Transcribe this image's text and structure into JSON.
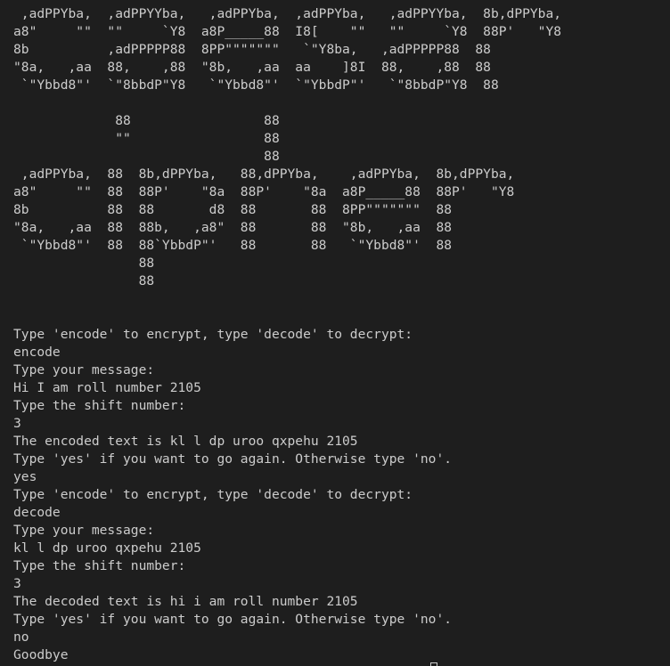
{
  "colors": {
    "background": "#1e1e1e",
    "text": "#cccccc"
  },
  "banner": [
    " ,adPPYba,  ,adPPYYba,   ,adPPYba,  ,adPPYba,   ,adPPYYba,  8b,dPPYba,",
    "a8\"     \"\"  \"\"     `Y8  a8P_____88  I8[    \"\"   \"\"     `Y8  88P'   \"Y8",
    "8b          ,adPPPPP88  8PP\"\"\"\"\"\"\"   `\"Y8ba,   ,adPPPPP88  88",
    "\"8a,   ,aa  88,    ,88  \"8b,   ,aa  aa    ]8I  88,    ,88  88",
    " `\"Ybbd8\"'  `\"8bbdP\"Y8   `\"Ybbd8\"'  `\"YbbdP\"'   `\"8bbdP\"Y8  88",
    "",
    "             88                 88",
    "             \"\"                 88",
    "                                88",
    " ,adPPYba,  88  8b,dPPYba,   88,dPPYba,    ,adPPYba,  8b,dPPYba,",
    "a8\"     \"\"  88  88P'    \"8a  88P'    \"8a  a8P_____88  88P'   \"Y8",
    "8b          88  88       d8  88       88  8PP\"\"\"\"\"\"\"  88",
    "\"8a,   ,aa  88  88b,   ,a8\"  88       88  \"8b,   ,aa  88",
    " `\"Ybbd8\"'  88  88`YbbdP\"'   88       88   `\"Ybbd8\"'  88",
    "                88",
    "                88"
  ],
  "session": [
    {
      "kind": "blank",
      "text": ""
    },
    {
      "kind": "blank",
      "text": ""
    },
    {
      "kind": "prompt",
      "text": "Type 'encode' to encrypt, type 'decode' to decrypt:"
    },
    {
      "kind": "input",
      "text": "encode"
    },
    {
      "kind": "prompt",
      "text": "Type your message:"
    },
    {
      "kind": "input",
      "text": "Hi I am roll number 2105"
    },
    {
      "kind": "prompt",
      "text": "Type the shift number:"
    },
    {
      "kind": "input",
      "text": "3"
    },
    {
      "kind": "output",
      "text": "The encoded text is kl l dp uroo qxpehu 2105"
    },
    {
      "kind": "prompt",
      "text": "Type 'yes' if you want to go again. Otherwise type 'no'."
    },
    {
      "kind": "input",
      "text": "yes"
    },
    {
      "kind": "prompt",
      "text": "Type 'encode' to encrypt, type 'decode' to decrypt:"
    },
    {
      "kind": "input",
      "text": "decode"
    },
    {
      "kind": "prompt",
      "text": "Type your message:"
    },
    {
      "kind": "input",
      "text": "kl l dp uroo qxpehu 2105"
    },
    {
      "kind": "prompt",
      "text": "Type the shift number:"
    },
    {
      "kind": "input",
      "text": "3"
    },
    {
      "kind": "output",
      "text": "The decoded text is hi i am roll number 2105"
    },
    {
      "kind": "prompt",
      "text": "Type 'yes' if you want to go again. Otherwise type 'no'."
    },
    {
      "kind": "input",
      "text": "no"
    },
    {
      "kind": "output",
      "text": "Goodbye"
    }
  ]
}
